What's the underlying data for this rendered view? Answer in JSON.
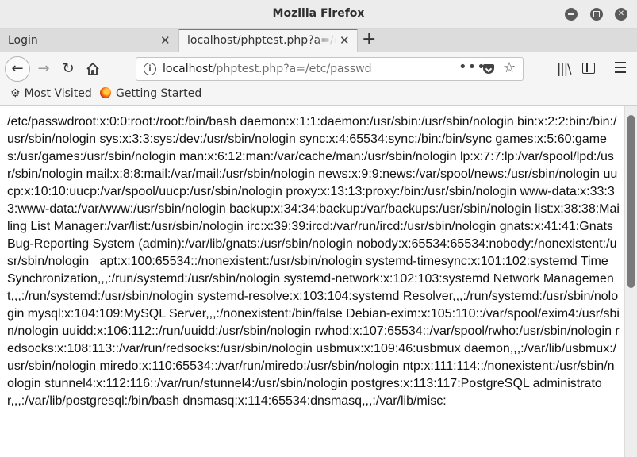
{
  "window": {
    "title": "Mozilla Firefox"
  },
  "tabs": [
    {
      "label": "Login",
      "active": false
    },
    {
      "label": "localhost/phptest.php?a=/etc/passwd",
      "active": true
    }
  ],
  "navbar": {
    "url_host": "localhost",
    "url_rest": "/phptest.php?a=/etc/passwd",
    "dots": "•••"
  },
  "bookmarks": [
    {
      "label": "Most Visited",
      "icon": "gear-icon"
    },
    {
      "label": "Getting Started",
      "icon": "firefox-icon"
    }
  ],
  "content": {
    "text": "/etc/passwdroot:x:0:0:root:/root:/bin/bash daemon:x:1:1:daemon:/usr/sbin:/usr/sbin/nologin bin:x:2:2:bin:/bin:/usr/sbin/nologin sys:x:3:3:sys:/dev:/usr/sbin/nologin sync:x:4:65534:sync:/bin:/bin/sync games:x:5:60:games:/usr/games:/usr/sbin/nologin man:x:6:12:man:/var/cache/man:/usr/sbin/nologin lp:x:7:7:lp:/var/spool/lpd:/usr/sbin/nologin mail:x:8:8:mail:/var/mail:/usr/sbin/nologin news:x:9:9:news:/var/spool/news:/usr/sbin/nologin uucp:x:10:10:uucp:/var/spool/uucp:/usr/sbin/nologin proxy:x:13:13:proxy:/bin:/usr/sbin/nologin www-data:x:33:33:www-data:/var/www:/usr/sbin/nologin backup:x:34:34:backup:/var/backups:/usr/sbin/nologin list:x:38:38:Mailing List Manager:/var/list:/usr/sbin/nologin irc:x:39:39:ircd:/var/run/ircd:/usr/sbin/nologin gnats:x:41:41:Gnats Bug-Reporting System (admin):/var/lib/gnats:/usr/sbin/nologin nobody:x:65534:65534:nobody:/nonexistent:/usr/sbin/nologin _apt:x:100:65534::/nonexistent:/usr/sbin/nologin systemd-timesync:x:101:102:systemd Time Synchronization,,,:/run/systemd:/usr/sbin/nologin systemd-network:x:102:103:systemd Network Management,,,:/run/systemd:/usr/sbin/nologin systemd-resolve:x:103:104:systemd Resolver,,,:/run/systemd:/usr/sbin/nologin mysql:x:104:109:MySQL Server,,,:/nonexistent:/bin/false Debian-exim:x:105:110::/var/spool/exim4:/usr/sbin/nologin uuidd:x:106:112::/run/uuidd:/usr/sbin/nologin rwhod:x:107:65534::/var/spool/rwho:/usr/sbin/nologin redsocks:x:108:113::/var/run/redsocks:/usr/sbin/nologin usbmux:x:109:46:usbmux daemon,,,:/var/lib/usbmux:/usr/sbin/nologin miredo:x:110:65534::/var/run/miredo:/usr/sbin/nologin ntp:x:111:114::/nonexistent:/usr/sbin/nologin stunnel4:x:112:116::/var/run/stunnel4:/usr/sbin/nologin postgres:x:113:117:PostgreSQL administrator,,,:/var/lib/postgresql:/bin/bash dnsmasq:x:114:65534:dnsmasq,,,:/var/lib/misc:"
  }
}
